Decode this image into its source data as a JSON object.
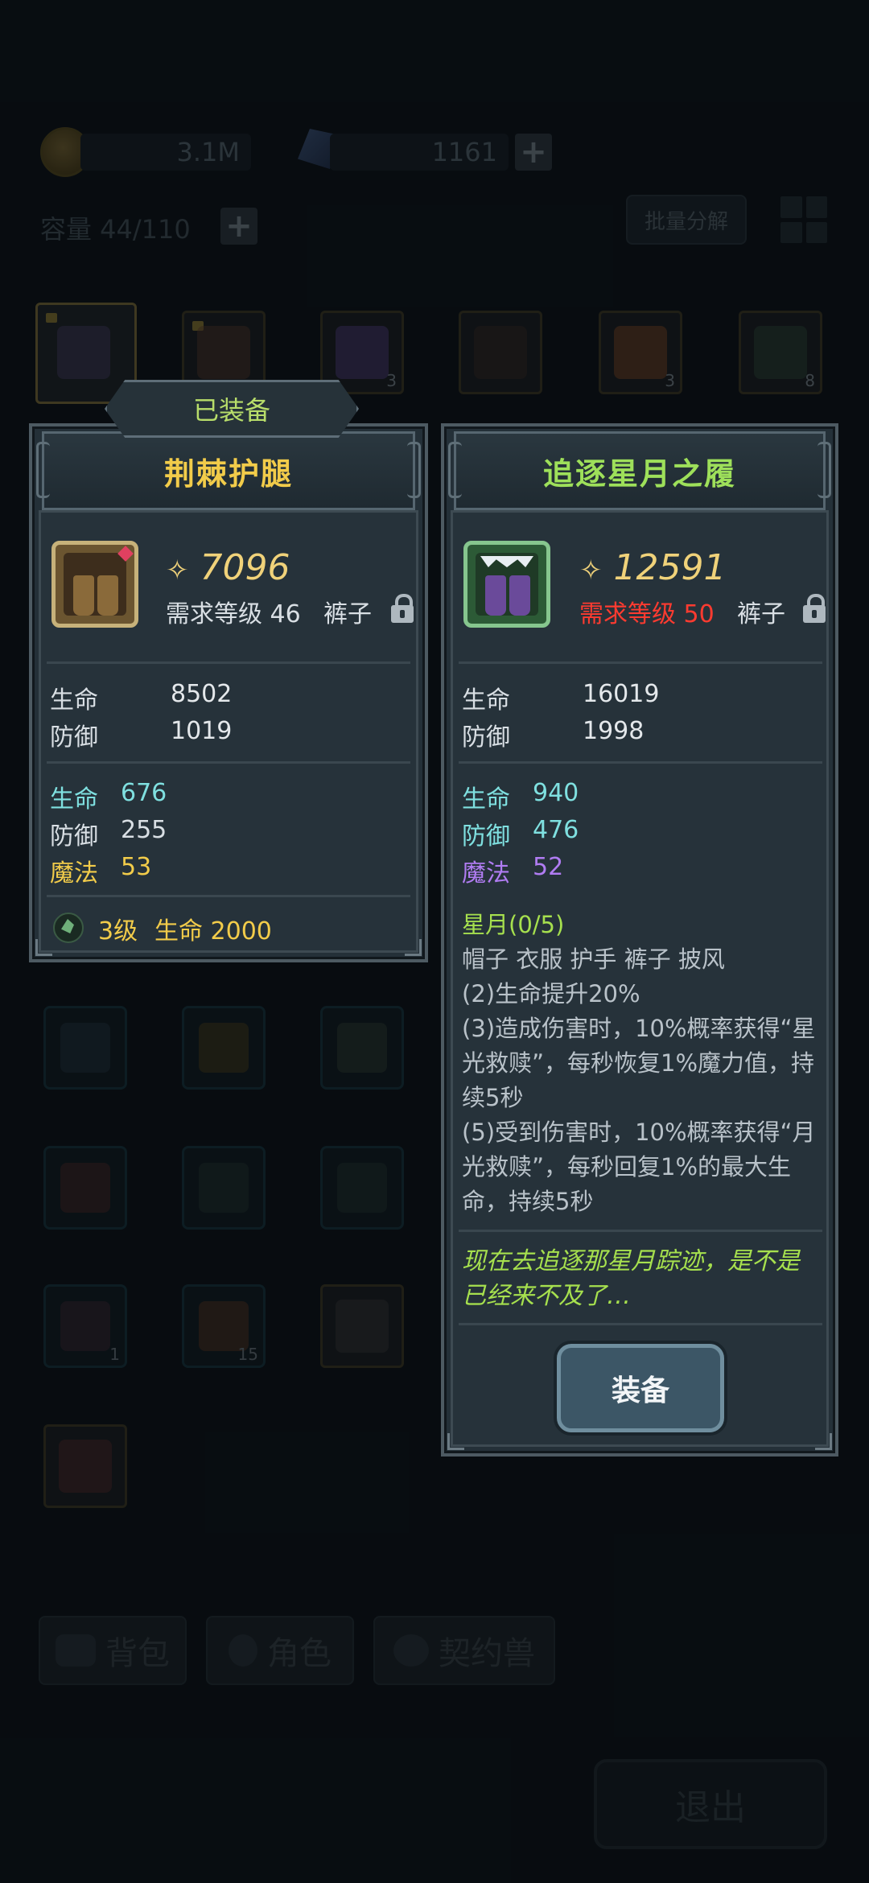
{
  "currency": {
    "gold": "3.1M",
    "gems": "1161"
  },
  "inventory": {
    "capacity": "容量 44/110",
    "batch_label": "批量分解",
    "top_slots": [
      {
        "qty": ""
      },
      {
        "qty": ""
      },
      {
        "qty": "3"
      },
      {
        "qty": ""
      },
      {
        "qty": "3"
      },
      {
        "qty": "8"
      }
    ],
    "grid_slots": [
      {
        "qty": ""
      },
      {
        "qty": ""
      },
      {
        "qty": ""
      },
      {
        "qty": ""
      },
      {
        "qty": ""
      },
      {
        "qty": ""
      },
      {
        "qty": "1"
      },
      {
        "qty": "15"
      },
      {
        "qty": ""
      },
      {
        "qty": ""
      }
    ]
  },
  "tabs": [
    {
      "label": "背包",
      "icon": "backpack-icon"
    },
    {
      "label": "角色",
      "icon": "character-icon"
    },
    {
      "label": "契约兽",
      "icon": "paw-icon"
    }
  ],
  "exit_label": "退出",
  "equipped": {
    "tag": "已装备",
    "name": "荆棘护腿",
    "name_color": "#f2cc4a",
    "power": "7096",
    "req_level": "需求等级 46",
    "slot_type": "裤子",
    "base_stats": [
      {
        "k": "生命",
        "v": "8502"
      },
      {
        "k": "防御",
        "v": "1019"
      }
    ],
    "bonus_stats": [
      {
        "k": "生命",
        "v": "676",
        "color": "#7fe0e0"
      },
      {
        "k": "防御",
        "v": "255",
        "color": "#7fe0e0"
      },
      {
        "k": "魔法",
        "v": "53",
        "color": "#f2cc4a"
      }
    ],
    "gem_level": "3级",
    "gem_bonus": "生命 2000"
  },
  "candidate": {
    "name": "追逐星月之履",
    "name_color": "#9ee05a",
    "power": "12591",
    "req_level": "需求等级 50",
    "req_color": "#ff3b30",
    "slot_type": "裤子",
    "base_stats": [
      {
        "k": "生命",
        "v": "16019"
      },
      {
        "k": "防御",
        "v": "1998"
      }
    ],
    "bonus_stats": [
      {
        "k": "生命",
        "v": "940",
        "color": "#7fe0e0"
      },
      {
        "k": "防御",
        "v": "476",
        "color": "#7fe0e0"
      },
      {
        "k": "魔法",
        "v": "52",
        "color": "#b07cf2"
      }
    ],
    "set_title": "星月(0/5)",
    "set_pieces": "帽子 衣服 护手 裤子 披风",
    "set_effects": [
      "(2)生命提升20%",
      "(3)造成伤害时，10%概率获得“星光救赎”，每秒恢复1%魔力值，持续5秒",
      "(5)受到伤害时，10%概率获得“月光救赎”，每秒回复1%的最大生命，持续5秒"
    ],
    "flavor": "现在去追逐那星月踪迹，是不是已经来不及了…",
    "equip_label": "装备"
  }
}
